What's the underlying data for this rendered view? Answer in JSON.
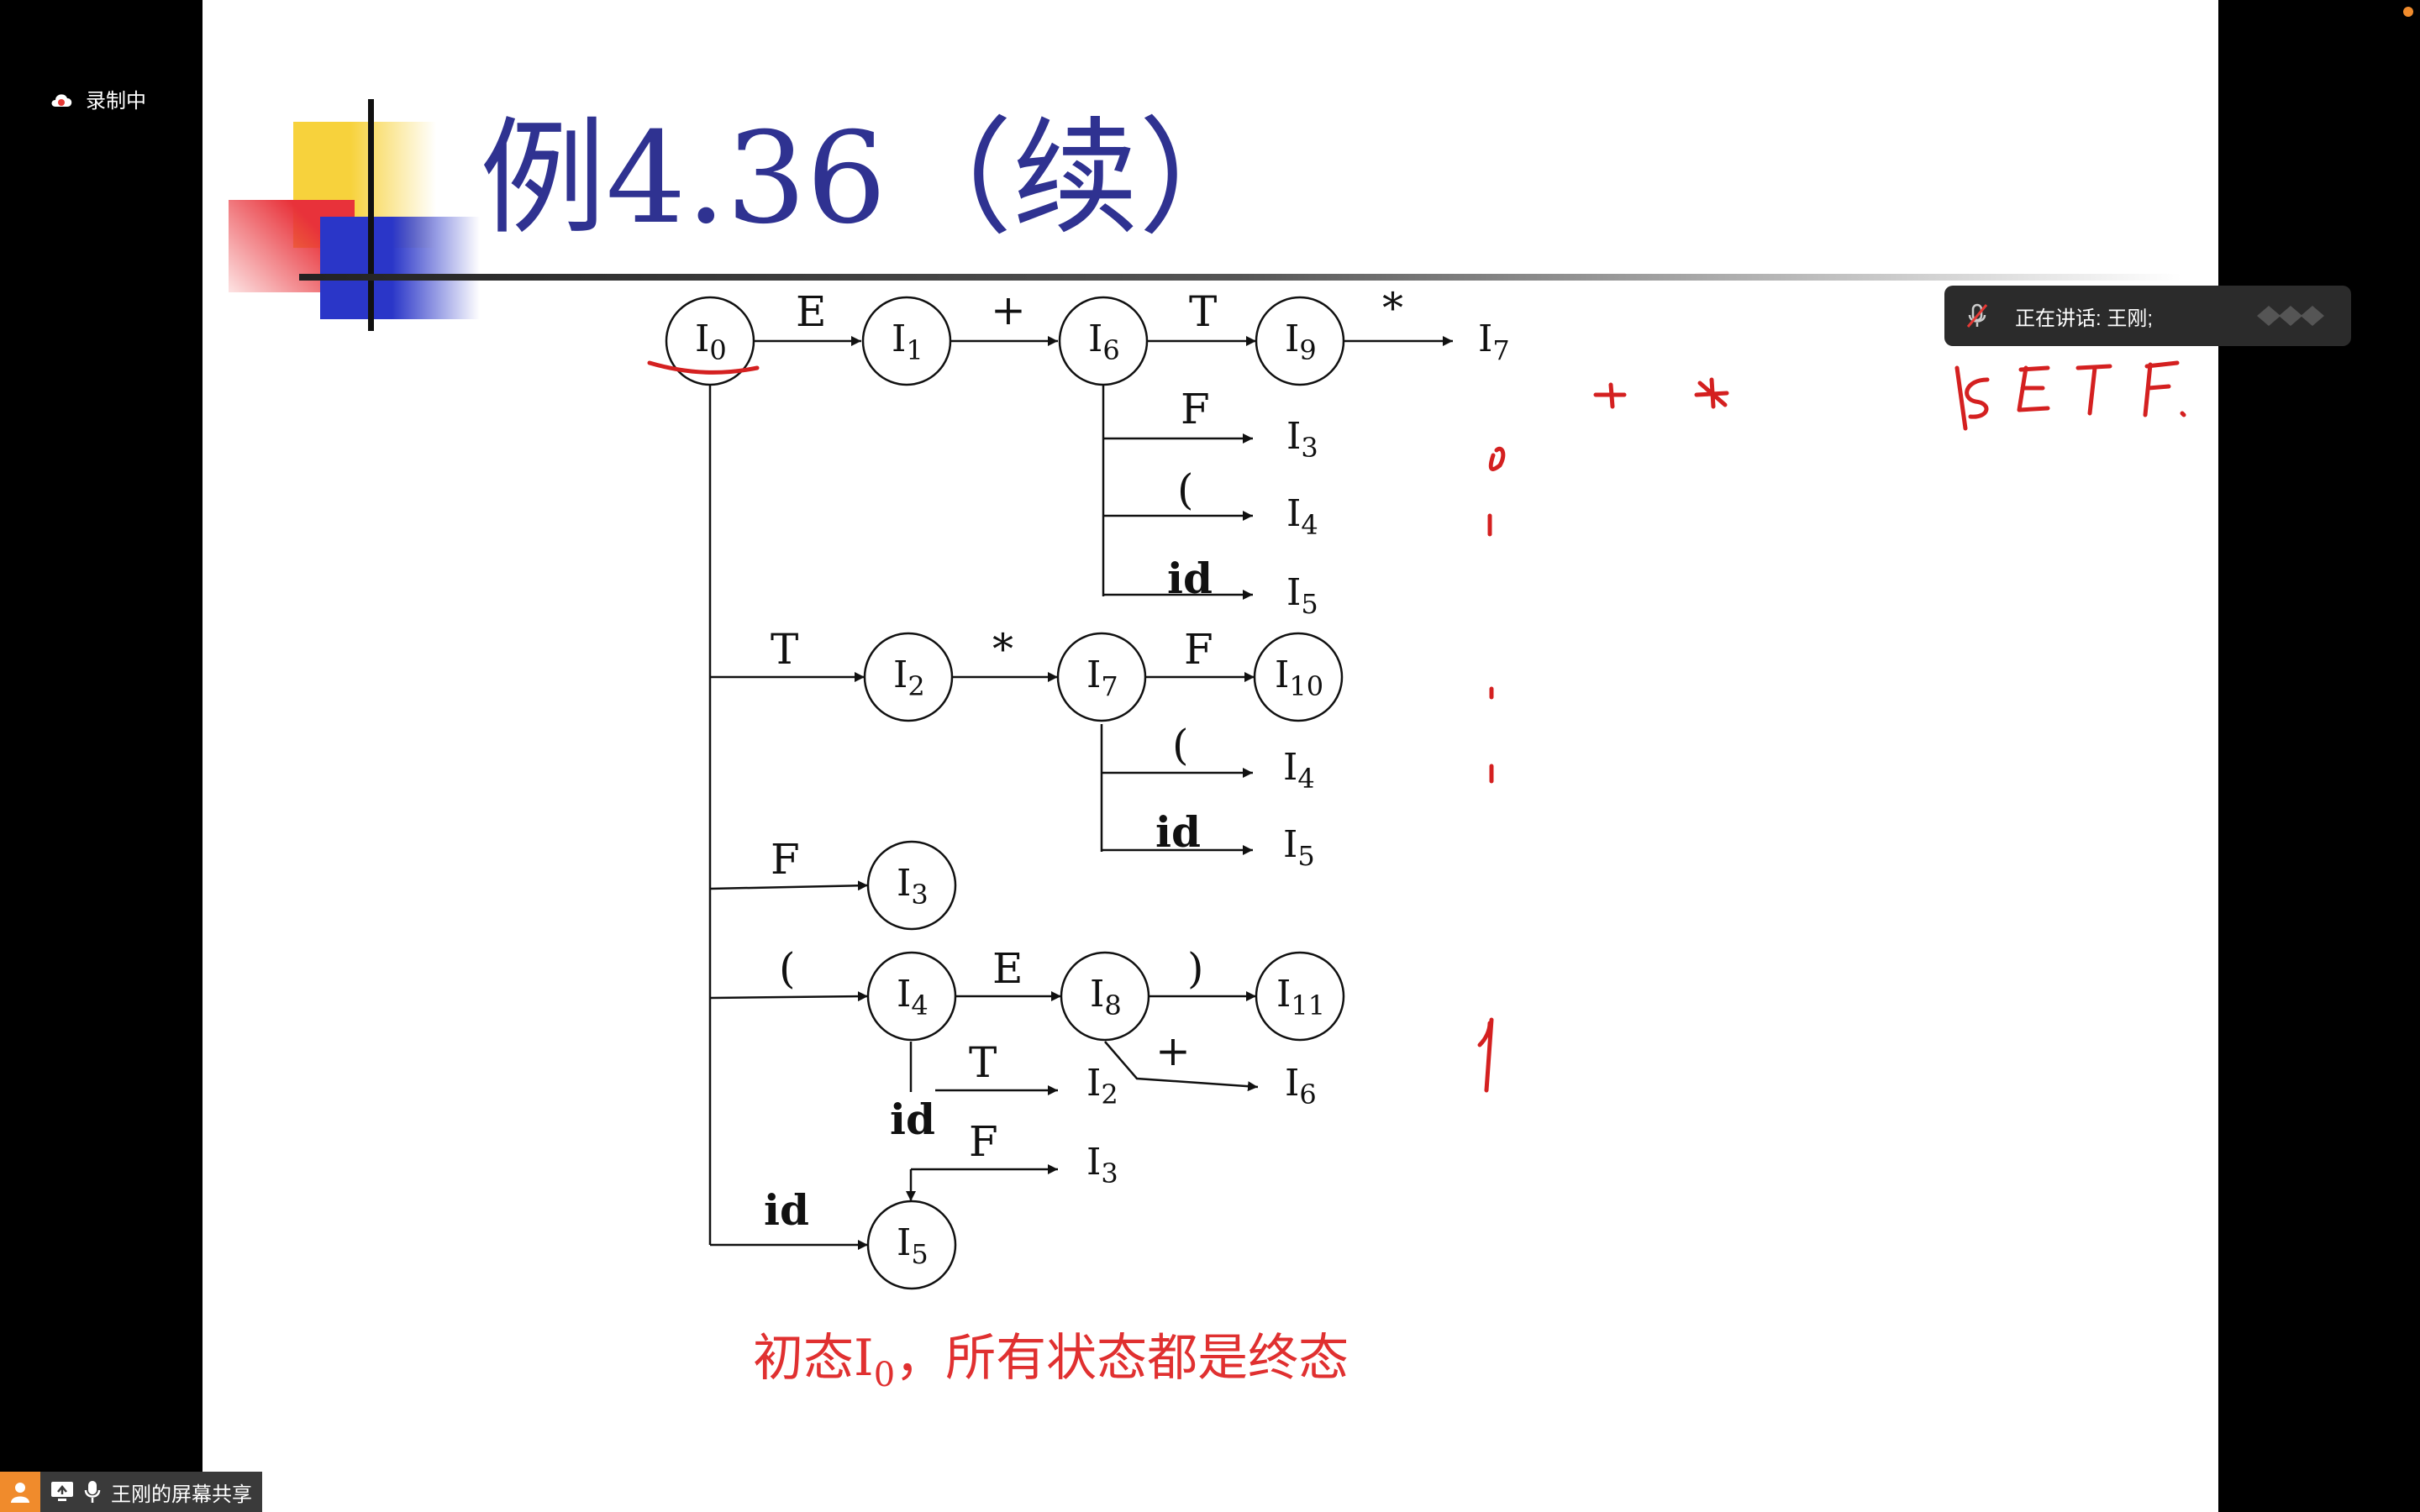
{
  "recording": {
    "label": "录制中"
  },
  "speaking": {
    "text": "正在讲话: 王刚;"
  },
  "share": {
    "label": "王刚的屏幕共享"
  },
  "slide": {
    "title": "例4.36（续）",
    "caption_prefix": "初态I",
    "caption_sub": "0",
    "caption_suffix": "，所有状态都是终态"
  },
  "diagram": {
    "states": [
      {
        "id": "n0",
        "sub": "0"
      },
      {
        "id": "n1",
        "sub": "1"
      },
      {
        "id": "n6",
        "sub": "6"
      },
      {
        "id": "n9",
        "sub": "9"
      },
      {
        "id": "n2",
        "sub": "2"
      },
      {
        "id": "n7",
        "sub": "7"
      },
      {
        "id": "n10",
        "sub": "10"
      },
      {
        "id": "n3",
        "sub": "3"
      },
      {
        "id": "n4",
        "sub": "4"
      },
      {
        "id": "n8",
        "sub": "8"
      },
      {
        "id": "n11",
        "sub": "11"
      },
      {
        "id": "n5",
        "sub": "5"
      }
    ],
    "targets": [
      "7",
      "3",
      "4",
      "5",
      "4",
      "5",
      "2",
      "6",
      "3"
    ],
    "edge_labels": [
      "E",
      "+",
      "T",
      "*",
      "F",
      "(",
      "id",
      "T",
      "*",
      "F",
      "(",
      "id",
      "F",
      "(",
      "E",
      ")",
      "T",
      "+",
      "id",
      "F",
      "id"
    ]
  },
  "colors": {
    "title": "#2f3291",
    "caption": "#e03030",
    "ink": "#111111",
    "annotation": "#d42020"
  }
}
